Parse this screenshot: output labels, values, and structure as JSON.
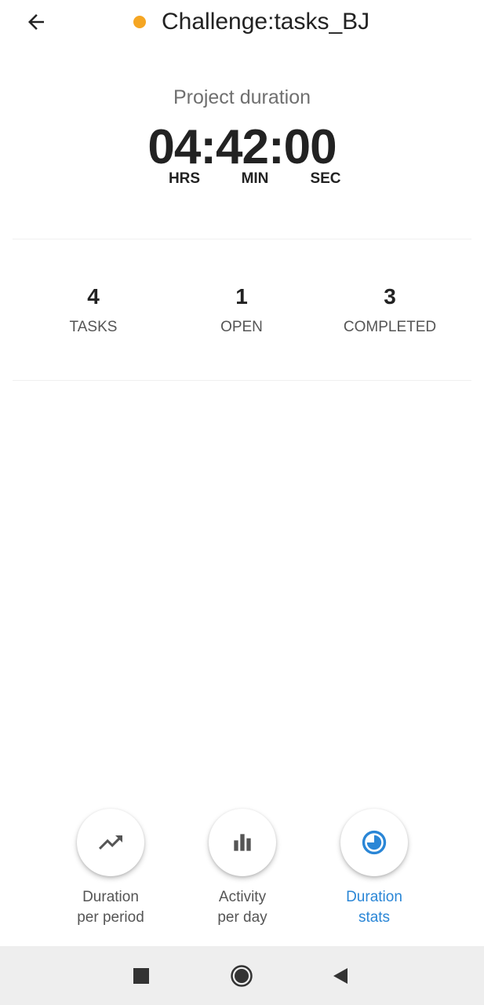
{
  "header": {
    "back_icon": "arrow-left-icon",
    "status_color": "#f5a623",
    "title": "Challenge:tasks_BJ"
  },
  "duration": {
    "label": "Project duration",
    "time": "04:42:00",
    "units": {
      "hrs": "HRS",
      "min": "MIN",
      "sec": "SEC"
    }
  },
  "stats": [
    {
      "value": "4",
      "label": "TASKS"
    },
    {
      "value": "1",
      "label": "OPEN"
    },
    {
      "value": "3",
      "label": "COMPLETED"
    }
  ],
  "actions": [
    {
      "icon": "trending-up-icon",
      "line1": "Duration",
      "line2": "per period",
      "active": false
    },
    {
      "icon": "bar-chart-icon",
      "line1": "Activity",
      "line2": "per day",
      "active": false
    },
    {
      "icon": "pie-chart-icon",
      "line1": "Duration",
      "line2": "stats",
      "active": true
    }
  ],
  "colors": {
    "accent": "#2a86d6",
    "status": "#f5a623",
    "icon_gray": "#555555"
  },
  "navbar": {
    "recent_icon": "square-icon",
    "home_icon": "circle-icon",
    "back_icon": "triangle-back-icon"
  }
}
